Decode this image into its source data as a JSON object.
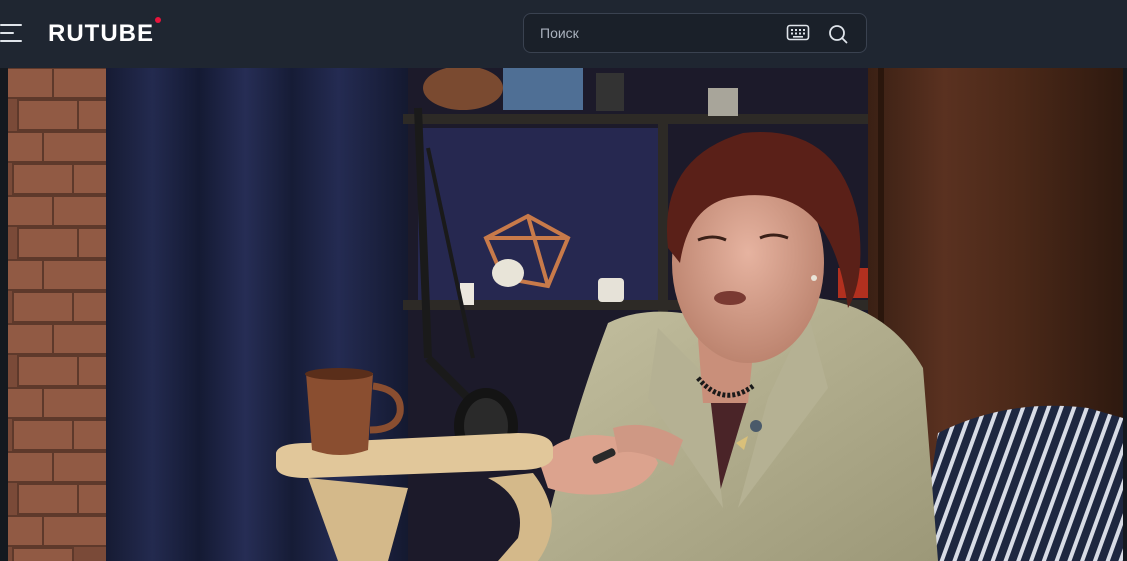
{
  "header": {
    "logo_text": "RUTUBE",
    "brand_accent": "#e8143c",
    "search": {
      "placeholder": "Поиск",
      "value": ""
    },
    "icons": {
      "menu": "hamburger-menu-icon",
      "keyboard": "keyboard-icon",
      "search": "search-icon"
    }
  },
  "player": {
    "scene": "video-frame"
  }
}
